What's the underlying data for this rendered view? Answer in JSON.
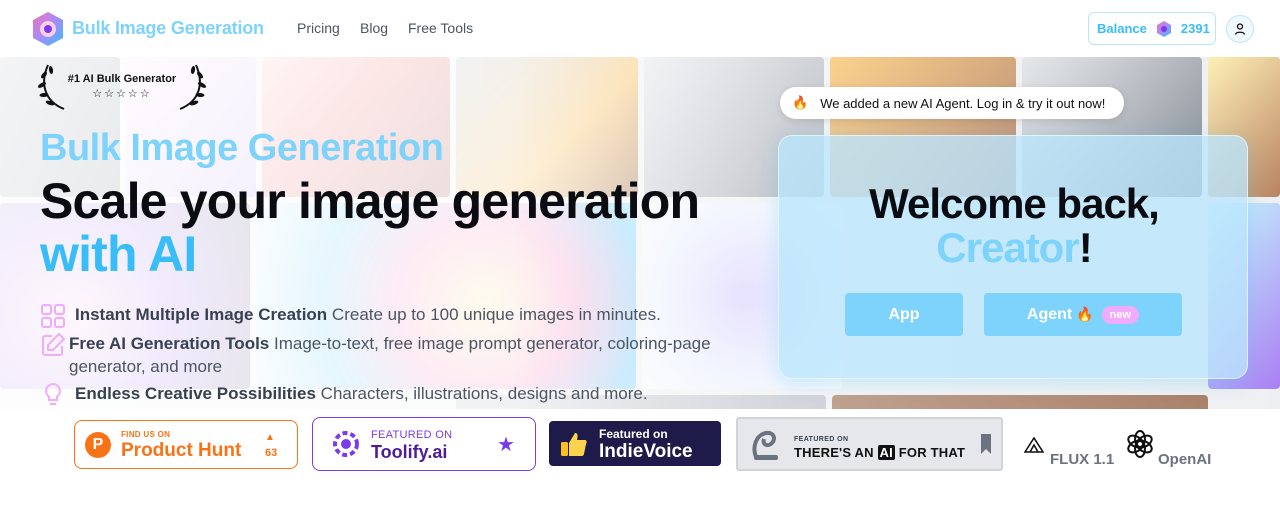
{
  "nav": {
    "brand": "Bulk Image Generation",
    "links": [
      "Pricing",
      "Blog",
      "Free Tools"
    ],
    "balance_label": "Balance",
    "balance_value": "2391"
  },
  "hero": {
    "award_title": "#1 AI Bulk Generator",
    "award_stars": "☆☆☆☆☆",
    "subtitle": "Bulk Image Generation",
    "headline_part1": "Scale your image generation ",
    "headline_accent": "with AI",
    "features": [
      {
        "title": "Instant Multiple Image Creation",
        "desc": " Create up to 100 unique images in minutes.",
        "icon": "grid-icon"
      },
      {
        "title": "Free AI Generation Tools",
        "desc": " Image-to-text, free image prompt generator, coloring-page generator, and more",
        "icon": "edit-icon"
      },
      {
        "title": "Endless Creative Possibilities",
        "desc": " Characters, illustrations, designs and more.",
        "icon": "lightbulb-icon"
      }
    ]
  },
  "notice": {
    "icon": "🔥",
    "text": "We added a new AI Agent. Log in & try it out now!"
  },
  "welcome": {
    "line1": "Welcome back,",
    "name": "Creator",
    "exclaim": "!",
    "app_label": "App",
    "agent_label": "Agent",
    "agent_icon": "🔥",
    "new_label": "new"
  },
  "badges": {
    "producthunt": {
      "small": "FIND US ON",
      "big": "Product Hunt",
      "count": "63",
      "letter": "P"
    },
    "toolify": {
      "small": "FEATURED ON",
      "big": "Toolify.ai"
    },
    "indievoice": {
      "small": "Featured on",
      "big": "IndieVoice"
    },
    "taaft": {
      "small": "FEATURED ON",
      "big_pre": "THERE'S AN ",
      "big_ai": "AI",
      "big_post": " FOR THAT"
    },
    "flux": "FLUX 1.1",
    "openai": "OpenAI"
  },
  "colors": {
    "accent": "#7dd3fc",
    "accent_strong": "#38bdf8",
    "producthunt": "#f97316",
    "toolify": "#7c3aed",
    "indievoice_bg": "#1e1b4b"
  }
}
